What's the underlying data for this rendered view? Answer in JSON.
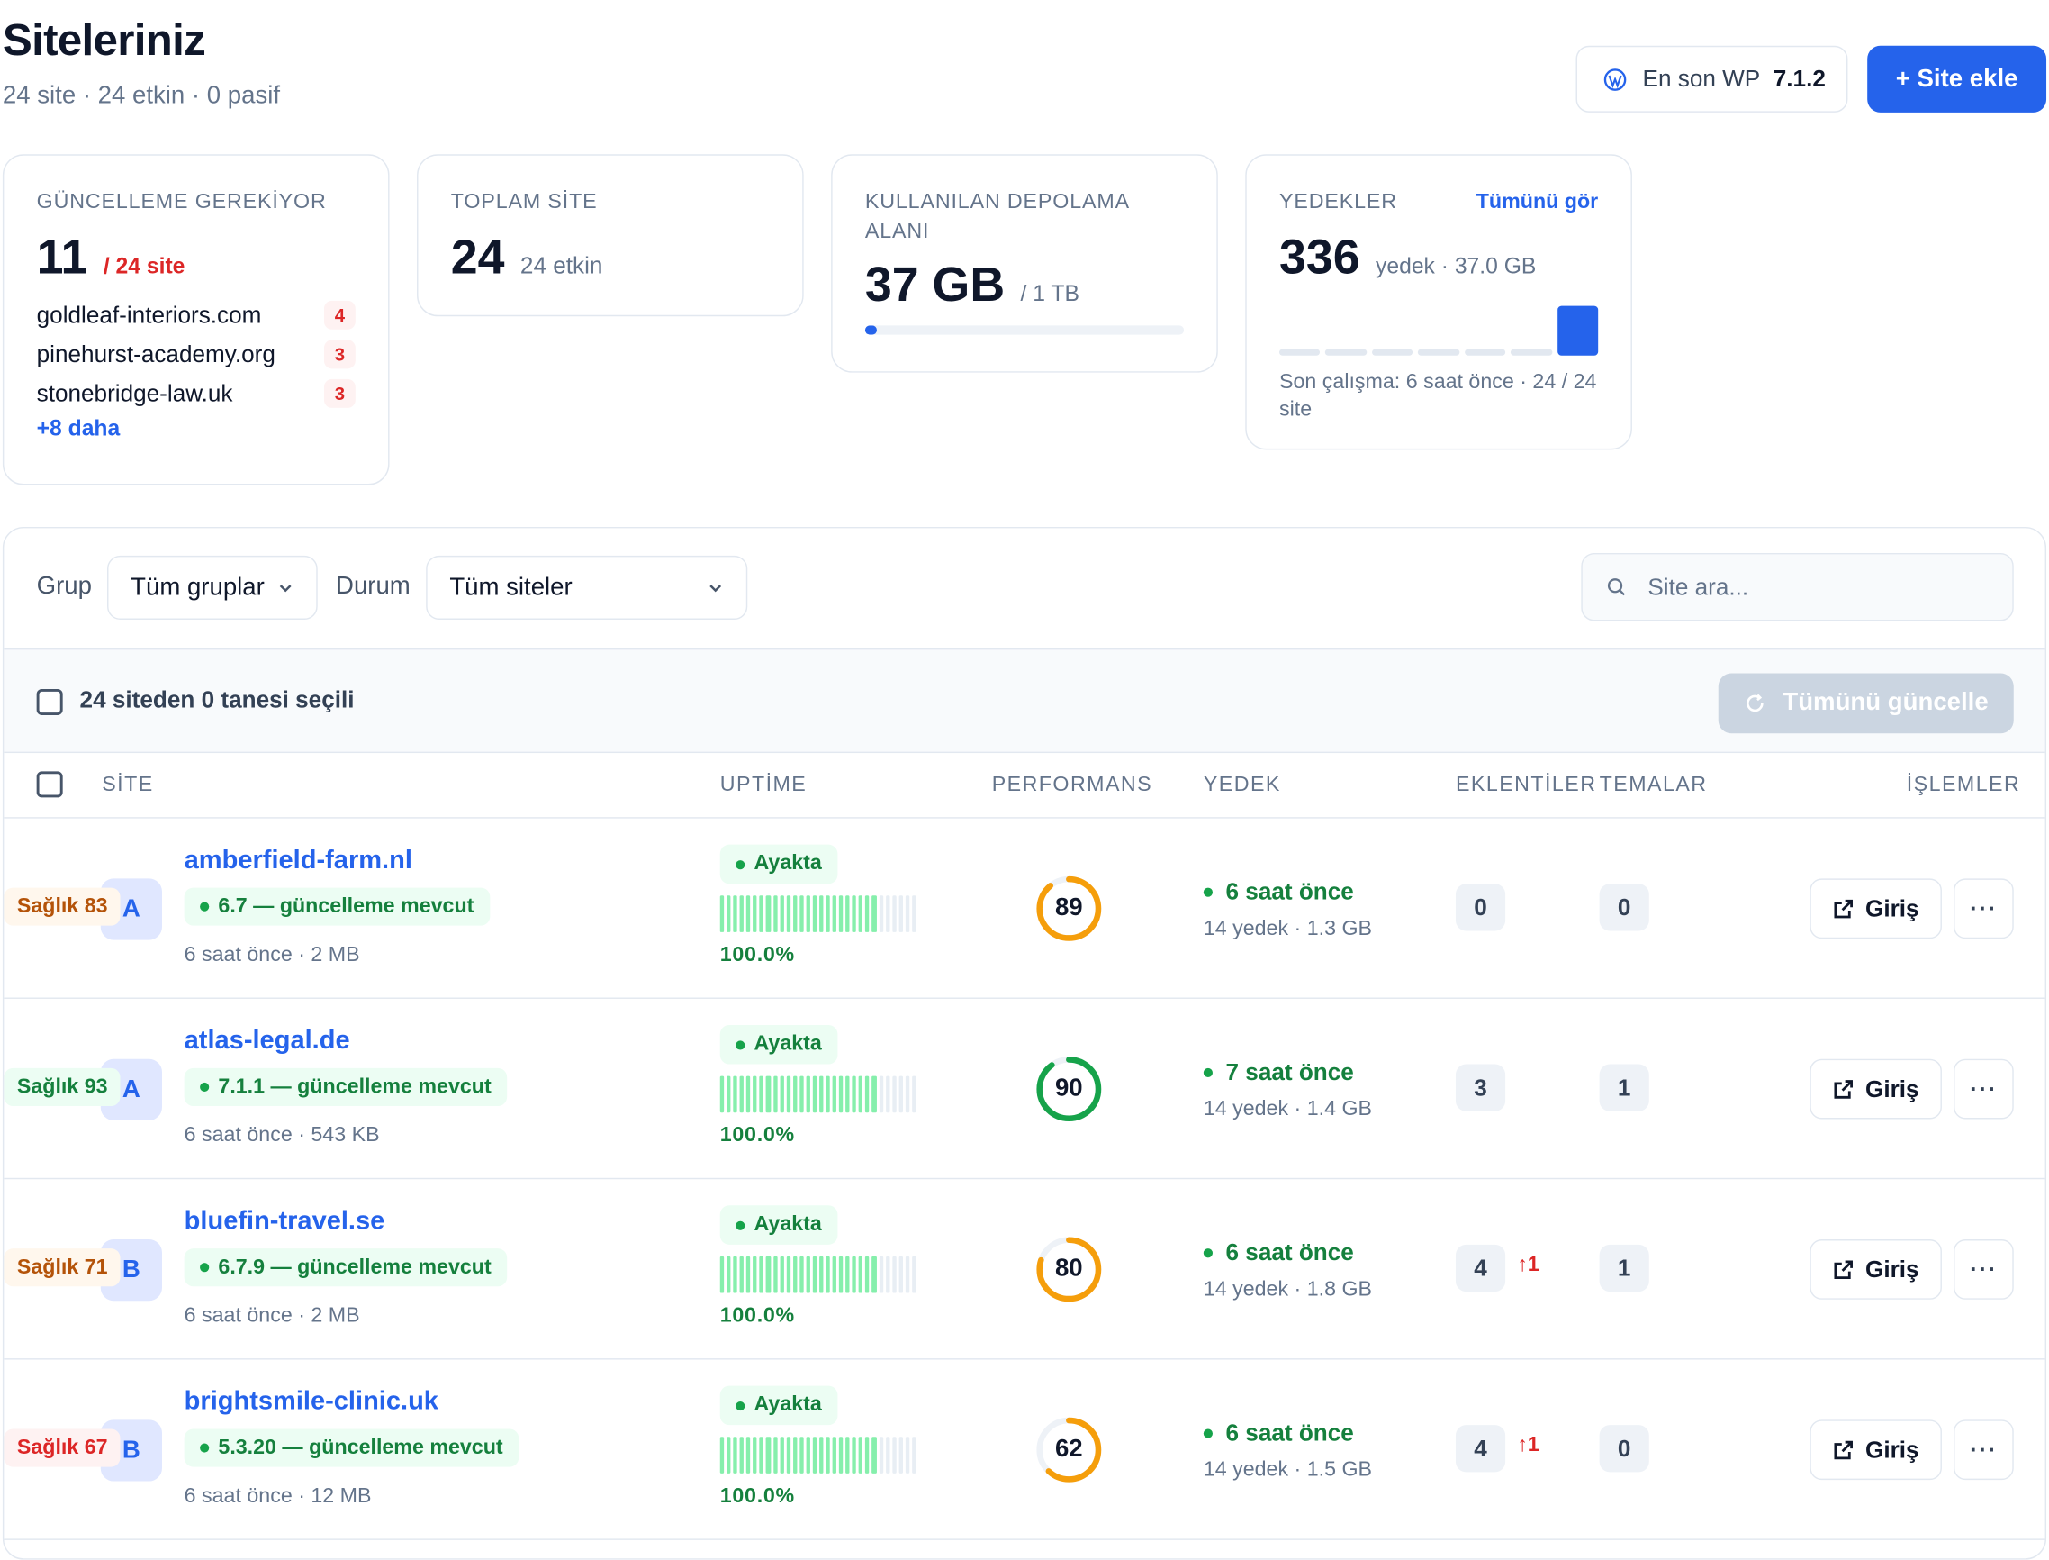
{
  "header": {
    "title": "Siteleriniz",
    "subtitle": "24 site · 24 etkin · 0 pasif",
    "wp_label": "En son WP",
    "wp_version": "7.1.2",
    "add_button": "+ Site ekle"
  },
  "cards": {
    "updates": {
      "label": "GÜNCELLEME GEREKİYOR",
      "value": "11",
      "of": "/ 24 site",
      "sites": [
        {
          "name": "goldleaf-interiors.com",
          "count": "4"
        },
        {
          "name": "pinehurst-academy.org",
          "count": "3"
        },
        {
          "name": "stonebridge-law.uk",
          "count": "3"
        }
      ],
      "more": "+8 daha"
    },
    "total": {
      "label": "TOPLAM SİTE",
      "value": "24",
      "sub": "24 etkin"
    },
    "storage": {
      "label": "KULLANILAN DEPOLAMA ALANI",
      "value": "37 GB",
      "sub": "/ 1 TB",
      "used_fraction": 0.037
    },
    "backups": {
      "label": "YEDEKLER",
      "link": "Tümünü gör",
      "value": "336",
      "sub": "yedek · 37.0 GB",
      "history_levels": [
        0.12,
        0.12,
        0.12,
        0.12,
        0.12,
        0.12,
        1.0
      ],
      "footer": "Son çalışma: 6 saat önce · 24 / 24 site"
    }
  },
  "filters": {
    "group_label": "Grup",
    "group_value": "Tüm gruplar",
    "status_label": "Durum",
    "status_value": "Tüm siteler",
    "search_placeholder": "Site ara..."
  },
  "selection": {
    "text": "24 siteden 0 tanesi seçili",
    "update_all": "Tümünü güncelle"
  },
  "columns": {
    "site": "SİTE",
    "uptime": "UPTİME",
    "performance": "PERFORMANS",
    "backup": "YEDEK",
    "plugins": "EKLENTİLER",
    "themes": "TEMALAR",
    "actions": "İŞLEMLER"
  },
  "login_label": "Giriş",
  "more_label": "···",
  "colors": {
    "primary": "#2563eb",
    "green": "#16a34a",
    "orange": "#f59e0b",
    "red": "#dc2626"
  },
  "rows": [
    {
      "initial": "A",
      "name": "amberfield-farm.nl",
      "version": "6.7 — güncelleme mevcut",
      "health": "Sağlık 83",
      "health_status": "warn",
      "meta": "6 saat önce · 2 MB",
      "uptime_status": "Ayakta",
      "uptime_pct": "100.0%",
      "perf": 89,
      "perf_status": "orange",
      "backup_time": "6 saat önce",
      "backup_meta": "14 yedek · 1.3 GB",
      "plugins": "0",
      "plugin_updates": "",
      "themes": "0"
    },
    {
      "initial": "A",
      "name": "atlas-legal.de",
      "version": "7.1.1 — güncelleme mevcut",
      "health": "Sağlık 93",
      "health_status": "good",
      "meta": "6 saat önce · 543 KB",
      "uptime_status": "Ayakta",
      "uptime_pct": "100.0%",
      "perf": 90,
      "perf_status": "green",
      "backup_time": "7 saat önce",
      "backup_meta": "14 yedek · 1.4 GB",
      "plugins": "3",
      "plugin_updates": "",
      "themes": "1"
    },
    {
      "initial": "B",
      "name": "bluefin-travel.se",
      "version": "6.7.9 — güncelleme mevcut",
      "health": "Sağlık 71",
      "health_status": "warn",
      "meta": "6 saat önce · 2 MB",
      "uptime_status": "Ayakta",
      "uptime_pct": "100.0%",
      "perf": 80,
      "perf_status": "orange",
      "backup_time": "6 saat önce",
      "backup_meta": "14 yedek · 1.8 GB",
      "plugins": "4",
      "plugin_updates": "↑1",
      "themes": "1"
    },
    {
      "initial": "B",
      "name": "brightsmile-clinic.uk",
      "version": "5.3.20 — güncelleme mevcut",
      "health": "Sağlık 67",
      "health_status": "bad",
      "meta": "6 saat önce · 12 MB",
      "uptime_status": "Ayakta",
      "uptime_pct": "100.0%",
      "perf": 62,
      "perf_status": "orange",
      "backup_time": "6 saat önce",
      "backup_meta": "14 yedek · 1.5 GB",
      "plugins": "4",
      "plugin_updates": "↑1",
      "themes": "0"
    }
  ]
}
